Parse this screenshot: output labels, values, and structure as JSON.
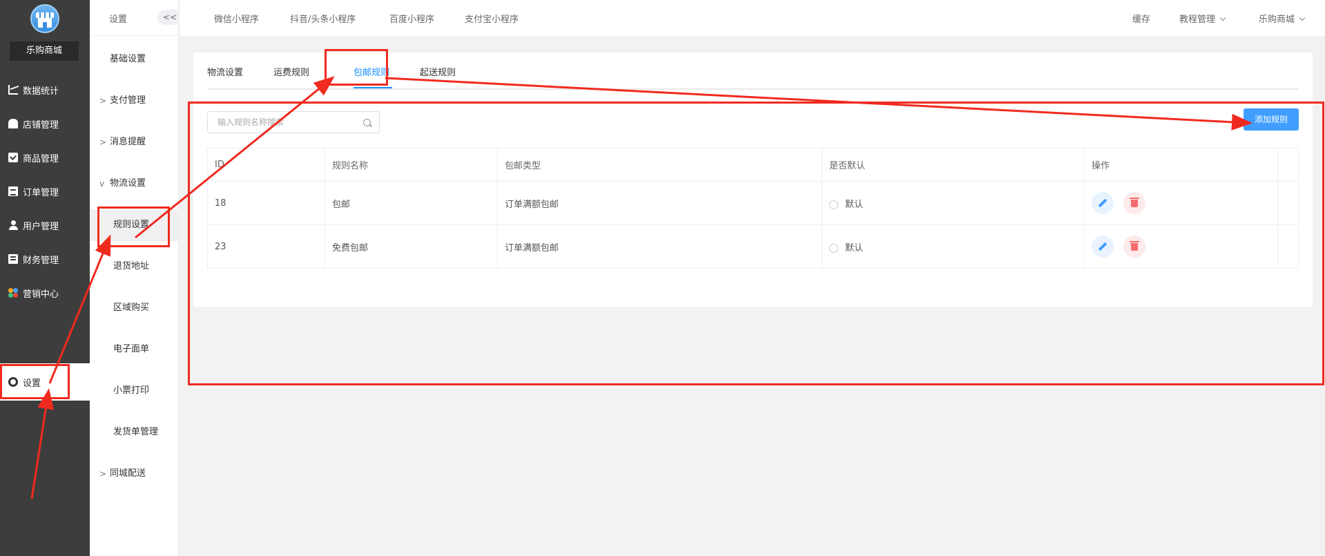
{
  "app": {
    "shop_name": "乐购商城"
  },
  "sidebar": {
    "items": [
      {
        "label": "数据统计",
        "icon": "chart-icon"
      },
      {
        "label": "店铺管理",
        "icon": "store-icon"
      },
      {
        "label": "商品管理",
        "icon": "goods-icon"
      },
      {
        "label": "订单管理",
        "icon": "order-icon"
      },
      {
        "label": "用户管理",
        "icon": "user-icon"
      },
      {
        "label": "财务管理",
        "icon": "finance-icon"
      },
      {
        "label": "营销中心",
        "icon": "marketing-icon"
      },
      {
        "label": "设置",
        "icon": "gear-icon",
        "active": true
      }
    ]
  },
  "subnav": {
    "title": "设置",
    "collapse": "<<",
    "items": [
      {
        "label": "基础设置"
      },
      {
        "label": "支付管理",
        "chevron": ">"
      },
      {
        "label": "消息提醒",
        "chevron": ">"
      },
      {
        "label": "物流设置",
        "chevron": "v",
        "expanded": true
      },
      {
        "label": "规则设置",
        "active": true
      },
      {
        "label": "退货地址"
      },
      {
        "label": "区域购买"
      },
      {
        "label": "电子面单"
      },
      {
        "label": "小票打印"
      },
      {
        "label": "发货单管理"
      },
      {
        "label": "同城配送",
        "chevron": ">"
      }
    ]
  },
  "topbar": {
    "tabs": [
      "微信小程序",
      "抖音/头条小程序",
      "百度小程序",
      "支付宝小程序"
    ],
    "right": {
      "cache": "缓存",
      "tutorial": "教程管理",
      "shop": "乐购商城"
    }
  },
  "content": {
    "tabs": [
      {
        "label": "物流设置"
      },
      {
        "label": "运费规则"
      },
      {
        "label": "包邮规则",
        "active": true
      },
      {
        "label": "起送规则"
      }
    ],
    "search": {
      "placeholder": "输入规则名称搜索",
      "value": ""
    },
    "add_button": "添加规则",
    "table": {
      "headers": [
        "ID",
        "规则名称",
        "包邮类型",
        "是否默认",
        "操作"
      ],
      "rows": [
        {
          "id": "18",
          "name": "包邮",
          "type": "订单满额包邮",
          "default_label": "默认"
        },
        {
          "id": "23",
          "name": "免费包邮",
          "type": "订单满额包邮",
          "default_label": "默认"
        }
      ]
    }
  },
  "colors": {
    "accent": "#409eff",
    "annotation": "#f02a1f",
    "sidebar_bg": "#3d3d3d"
  }
}
